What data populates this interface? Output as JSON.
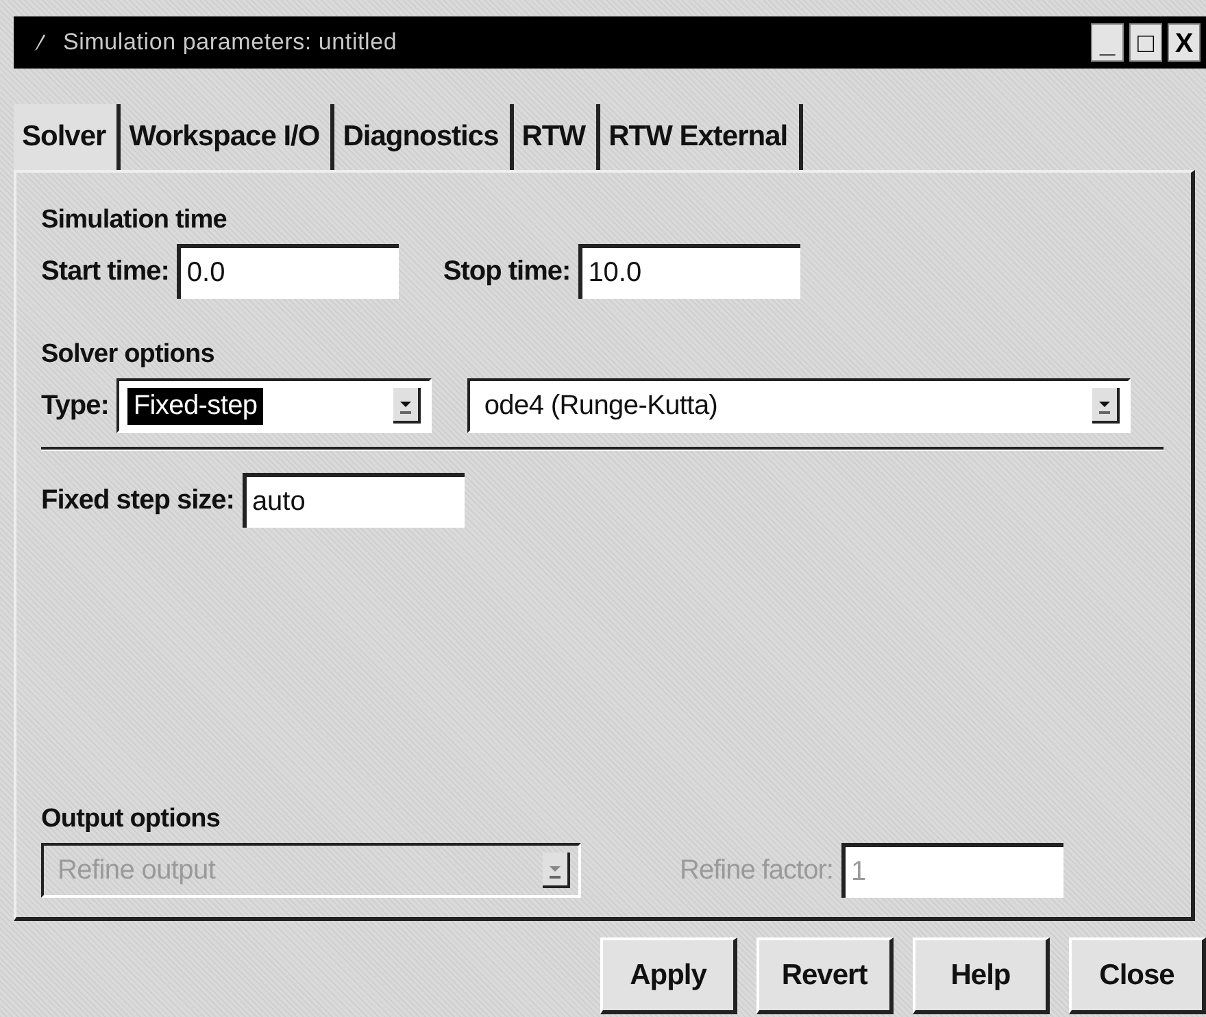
{
  "window": {
    "title": "Simulation parameters: untitled",
    "controls": [
      "_",
      "□",
      "X"
    ]
  },
  "tabs": [
    {
      "label": "Solver",
      "selected": true
    },
    {
      "label": "Workspace I/O",
      "selected": false
    },
    {
      "label": "Diagnostics",
      "selected": false
    },
    {
      "label": "RTW",
      "selected": false
    },
    {
      "label": "RTW External",
      "selected": false
    }
  ],
  "simulation_time": {
    "heading": "Simulation time",
    "start_label": "Start time:",
    "start_value": "0.0",
    "stop_label": "Stop time:",
    "stop_value": "10.0"
  },
  "solver_options": {
    "heading": "Solver options",
    "type_label": "Type:",
    "type_value": "Fixed-step",
    "type_highlighted": true,
    "solver_value": "ode4 (Runge-Kutta)",
    "step_label": "Fixed step size:",
    "step_value": "auto"
  },
  "output_options": {
    "heading": "Output options",
    "output_value": "Refine output",
    "output_disabled": true,
    "factor_label": "Refine factor:",
    "factor_value": "1",
    "factor_disabled": true
  },
  "buttons": [
    "Apply",
    "Revert",
    "Help",
    "Close"
  ]
}
